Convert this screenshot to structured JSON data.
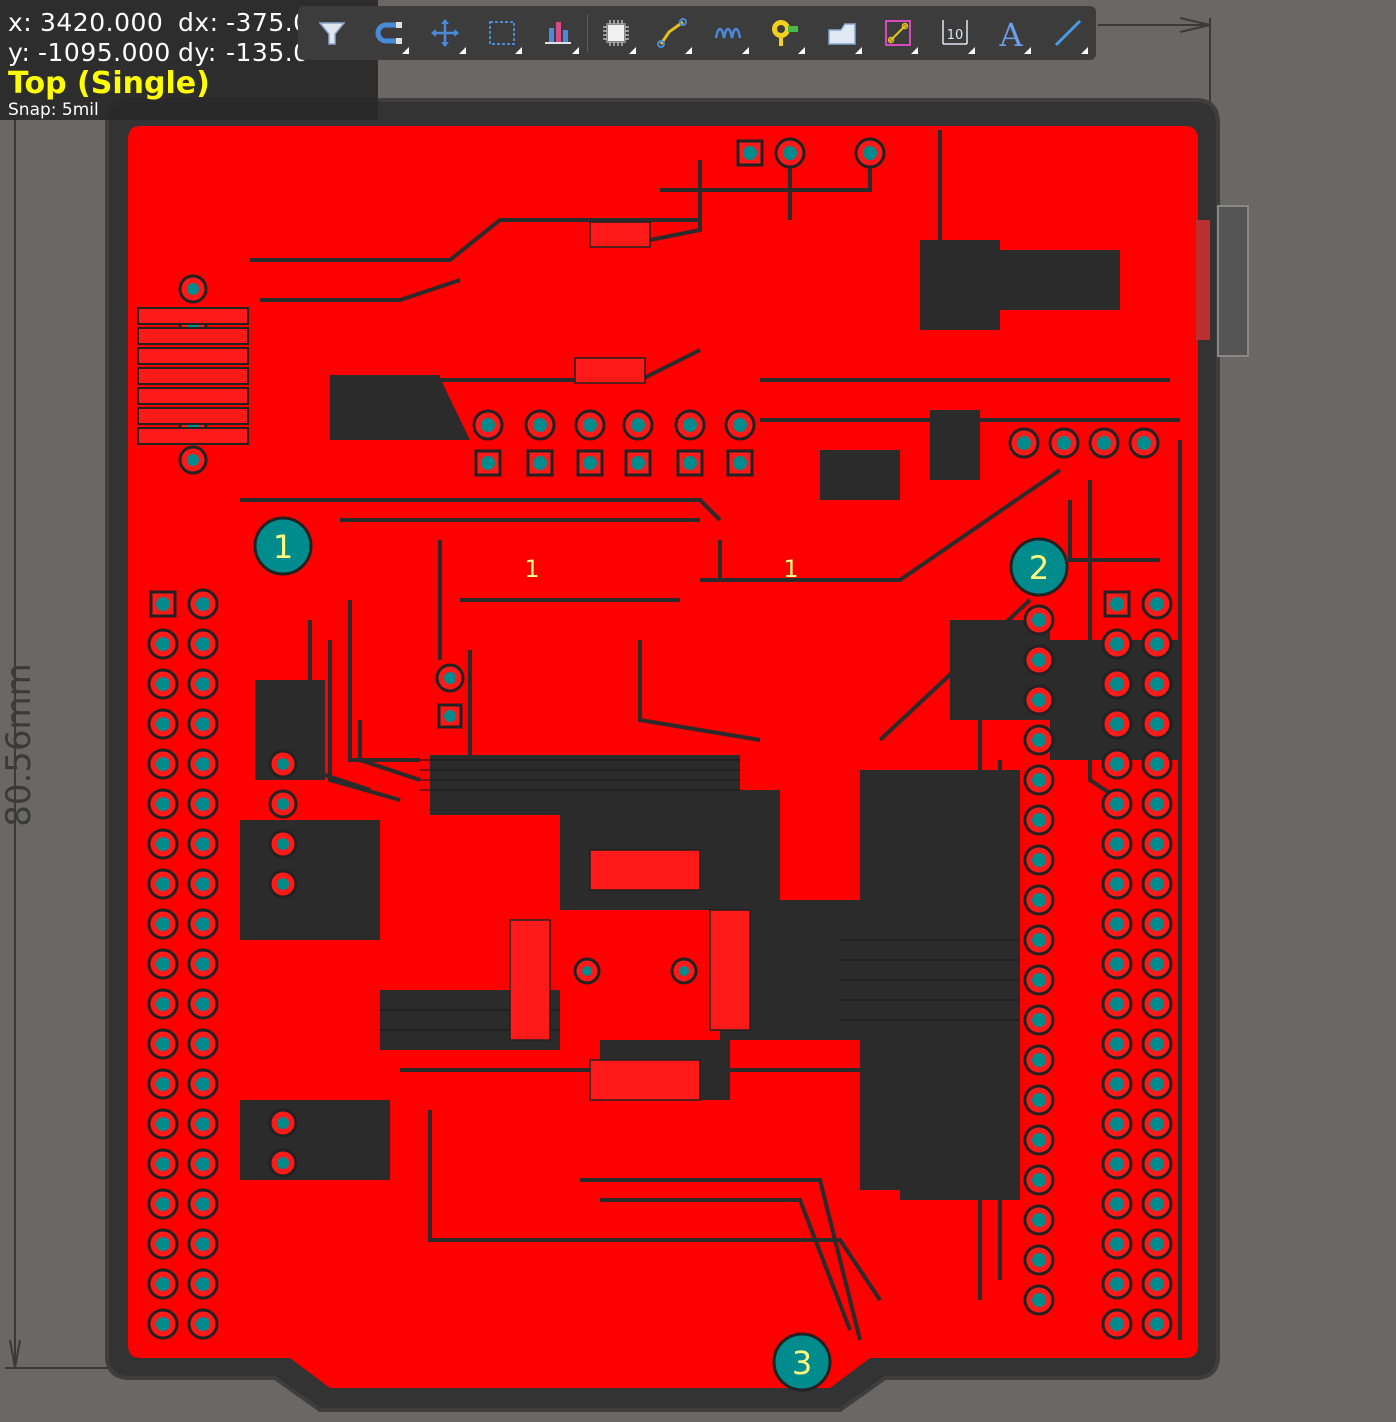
{
  "status": {
    "x_label": "x:",
    "x_value": "3420.000",
    "dx_label": "dx:",
    "dx_value": "-375.0",
    "y_label": "y:",
    "y_value": "-1095.000",
    "dy_label": "dy:",
    "dy_value": "-135.0",
    "layer": "Top (Single)",
    "snap": "Snap: 5mil"
  },
  "toolbar": {
    "tools": [
      {
        "icon": "filter-icon",
        "has_menu": false
      },
      {
        "icon": "magnet-icon",
        "has_menu": true
      },
      {
        "icon": "move-icon",
        "has_menu": true
      },
      {
        "icon": "select-rect-icon",
        "has_menu": true
      },
      {
        "icon": "align-icon",
        "has_menu": true
      },
      {
        "icon": "component-icon",
        "has_menu": true
      },
      {
        "icon": "route-track-icon",
        "has_menu": true
      },
      {
        "icon": "diff-pair-icon",
        "has_menu": true
      },
      {
        "icon": "via-icon",
        "has_menu": true
      },
      {
        "icon": "polygon-icon",
        "has_menu": true
      },
      {
        "icon": "keepout-icon",
        "has_menu": true
      },
      {
        "icon": "dimension-icon",
        "has_menu": true
      },
      {
        "icon": "text-icon",
        "has_menu": true
      },
      {
        "icon": "line-icon",
        "has_menu": true
      }
    ],
    "text_tool_label": "A",
    "dimension_tool_label": "10"
  },
  "board": {
    "dimension_label": "80.56mm",
    "mounting_holes": [
      "1",
      "2",
      "3"
    ],
    "component_labels": [
      "1",
      "1"
    ],
    "colors": {
      "copper": "#ff0000",
      "background": "#6b6766",
      "board_edge": "#333333",
      "pad": "#008c8c",
      "hole_label": "#ffff80"
    }
  }
}
